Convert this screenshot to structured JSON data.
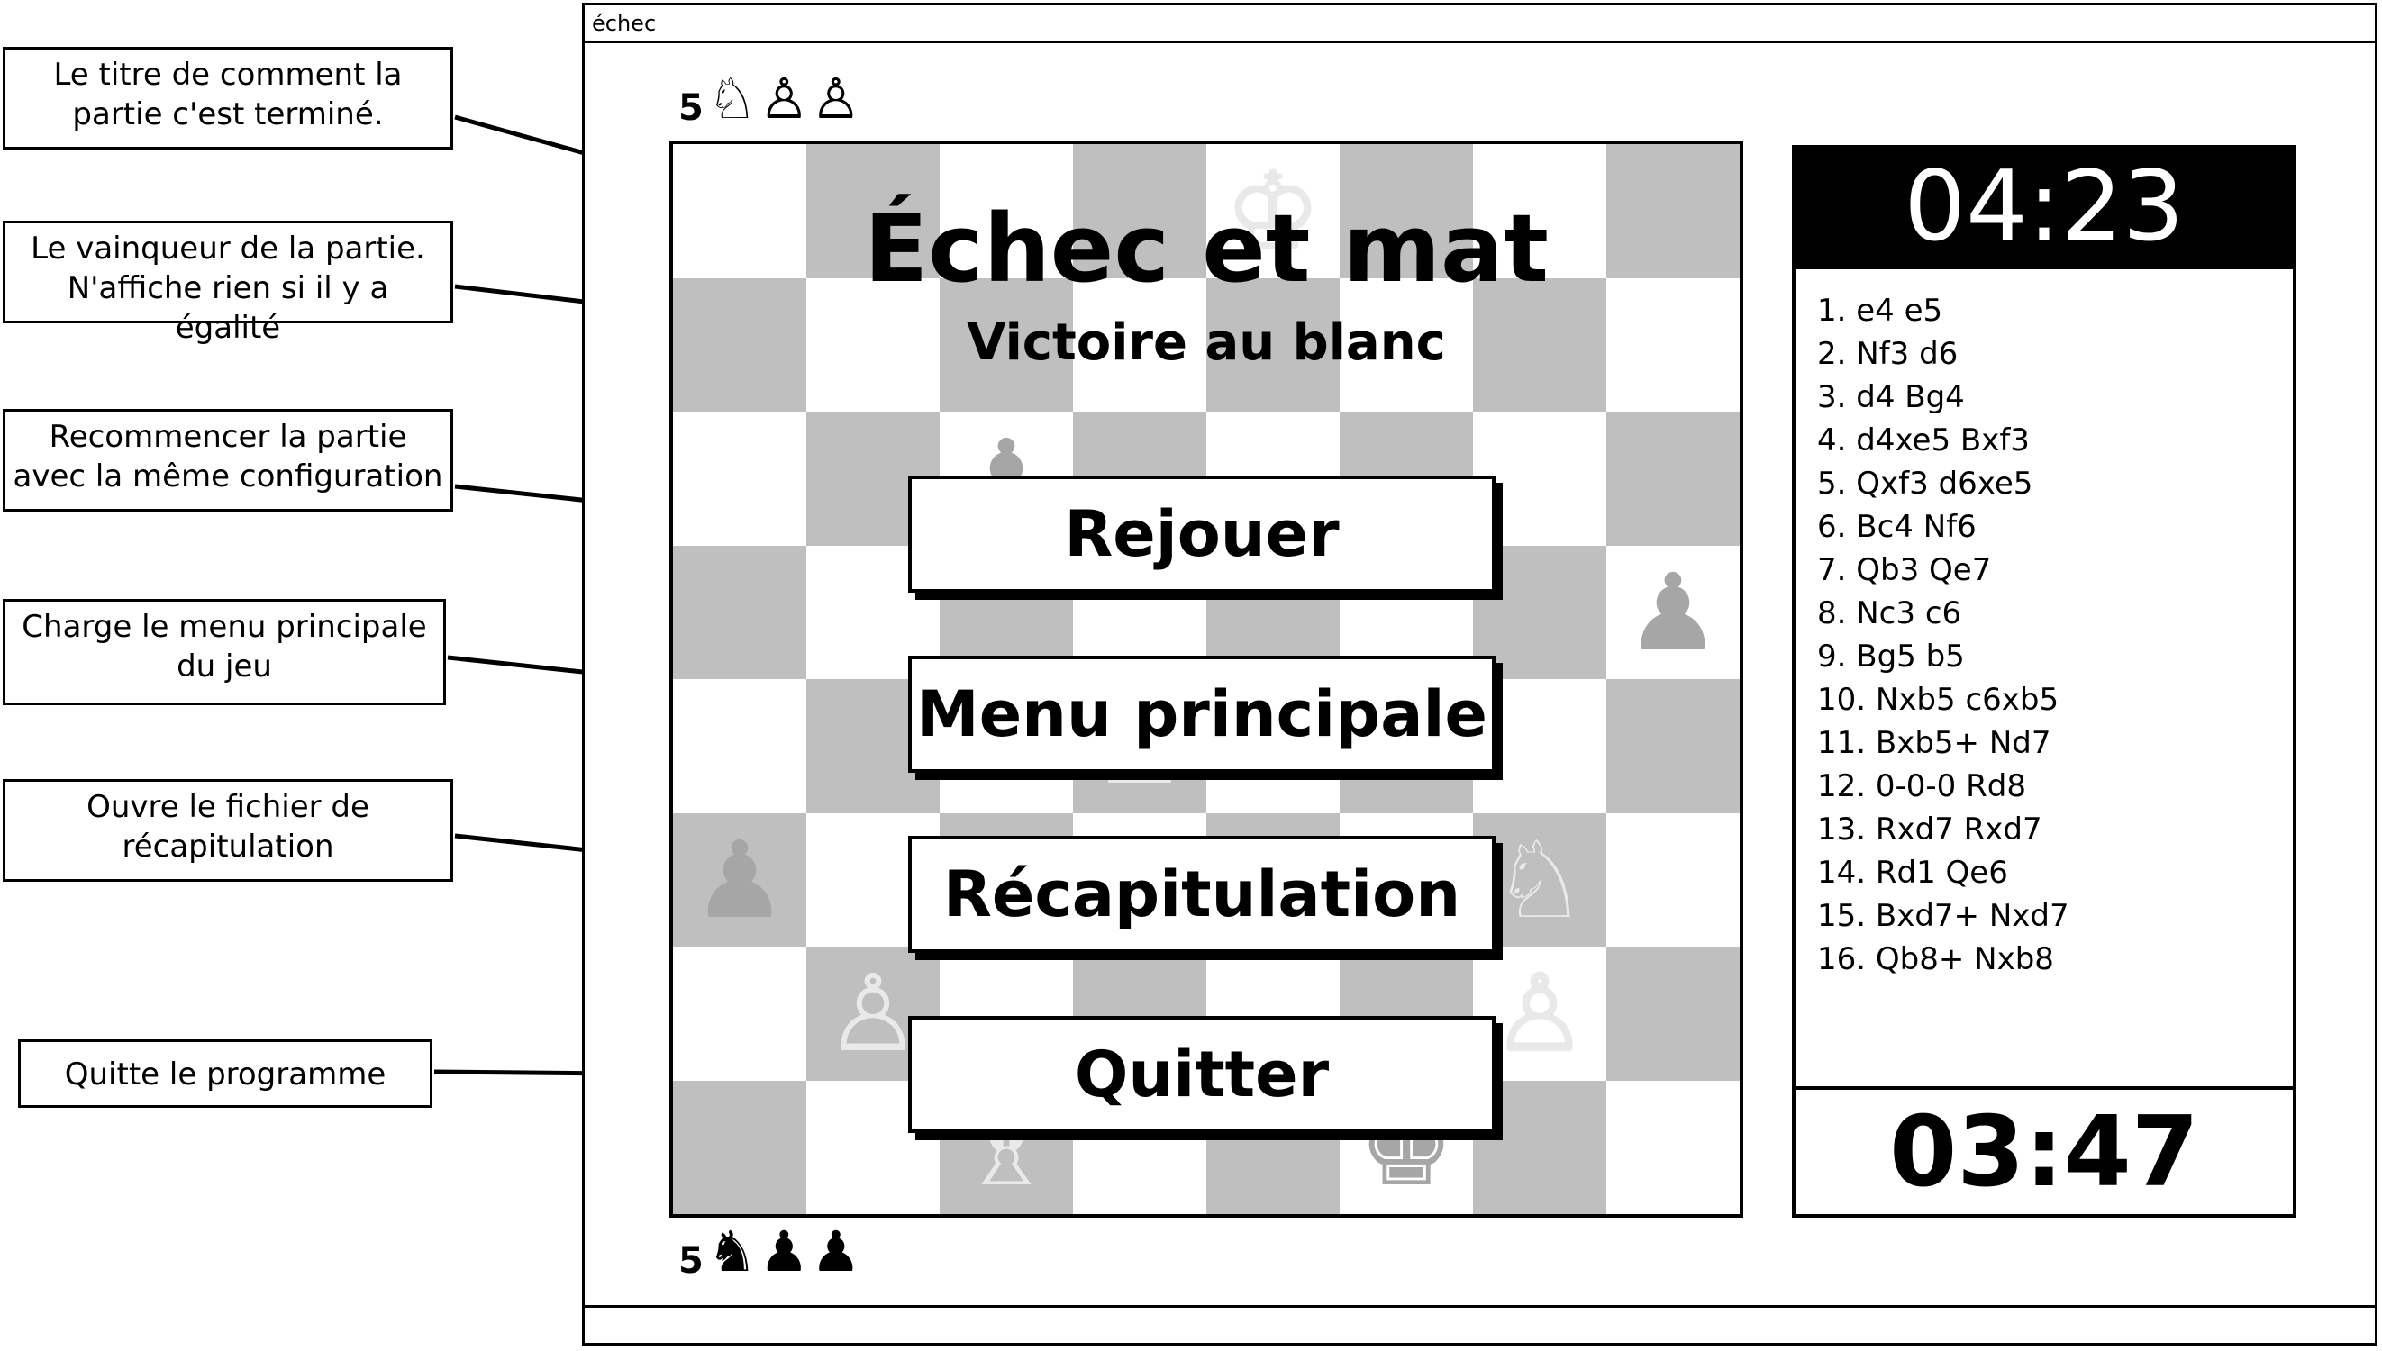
{
  "annotations": [
    {
      "text": "Le titre de comment la partie c'est terminé."
    },
    {
      "text": "Le vainqueur de la partie. N'affiche rien si il y a égalité"
    },
    {
      "text": "Recommencer la partie avec la même configuration"
    },
    {
      "text": "Charge le menu principale du jeu"
    },
    {
      "text": "Ouvre le fichier de récapitulation"
    },
    {
      "text": "Quitte le programme"
    }
  ],
  "window": {
    "title": "échec"
  },
  "captured_top": {
    "count": "5",
    "pieces": [
      "♘",
      "♙",
      "♙"
    ]
  },
  "captured_bottom": {
    "count": "5",
    "pieces": [
      "♞",
      "♟",
      "♟"
    ]
  },
  "board": {
    "pieces": {
      "0,4": "♔",
      "2,2": "♟",
      "3,7": "♟",
      "4,3": "♙",
      "5,0": "♟",
      "5,6": "♘",
      "6,1": "♙",
      "6,6": "♙",
      "7,2": "♗",
      "7,5": "♚"
    }
  },
  "result": {
    "title": "Échec et mat",
    "winner": "Victoire au blanc"
  },
  "buttons": {
    "replay": "Rejouer",
    "main_menu": "Menu principale",
    "recap": "Récapitulation",
    "quit": "Quitter"
  },
  "timers": {
    "top": "04:23",
    "bottom": "03:47"
  },
  "moves": [
    "1. e4 e5",
    "2. Nf3 d6",
    "3. d4 Bg4",
    "4. d4xe5 Bxf3",
    "5. Qxf3 d6xe5",
    "6. Bc4 Nf6",
    "7. Qb3 Qe7",
    "8. Nc3 c6",
    "9. Bg5 b5",
    "10. Nxb5 c6xb5",
    "11. Bxb5+ Nd7",
    "12. 0-0-0 Rd8",
    "13. Rxd7 Rxd7",
    "14. Rd1 Qe6",
    "15. Bxd7+ Nxd7",
    "16. Qb8+ Nxb8"
  ]
}
